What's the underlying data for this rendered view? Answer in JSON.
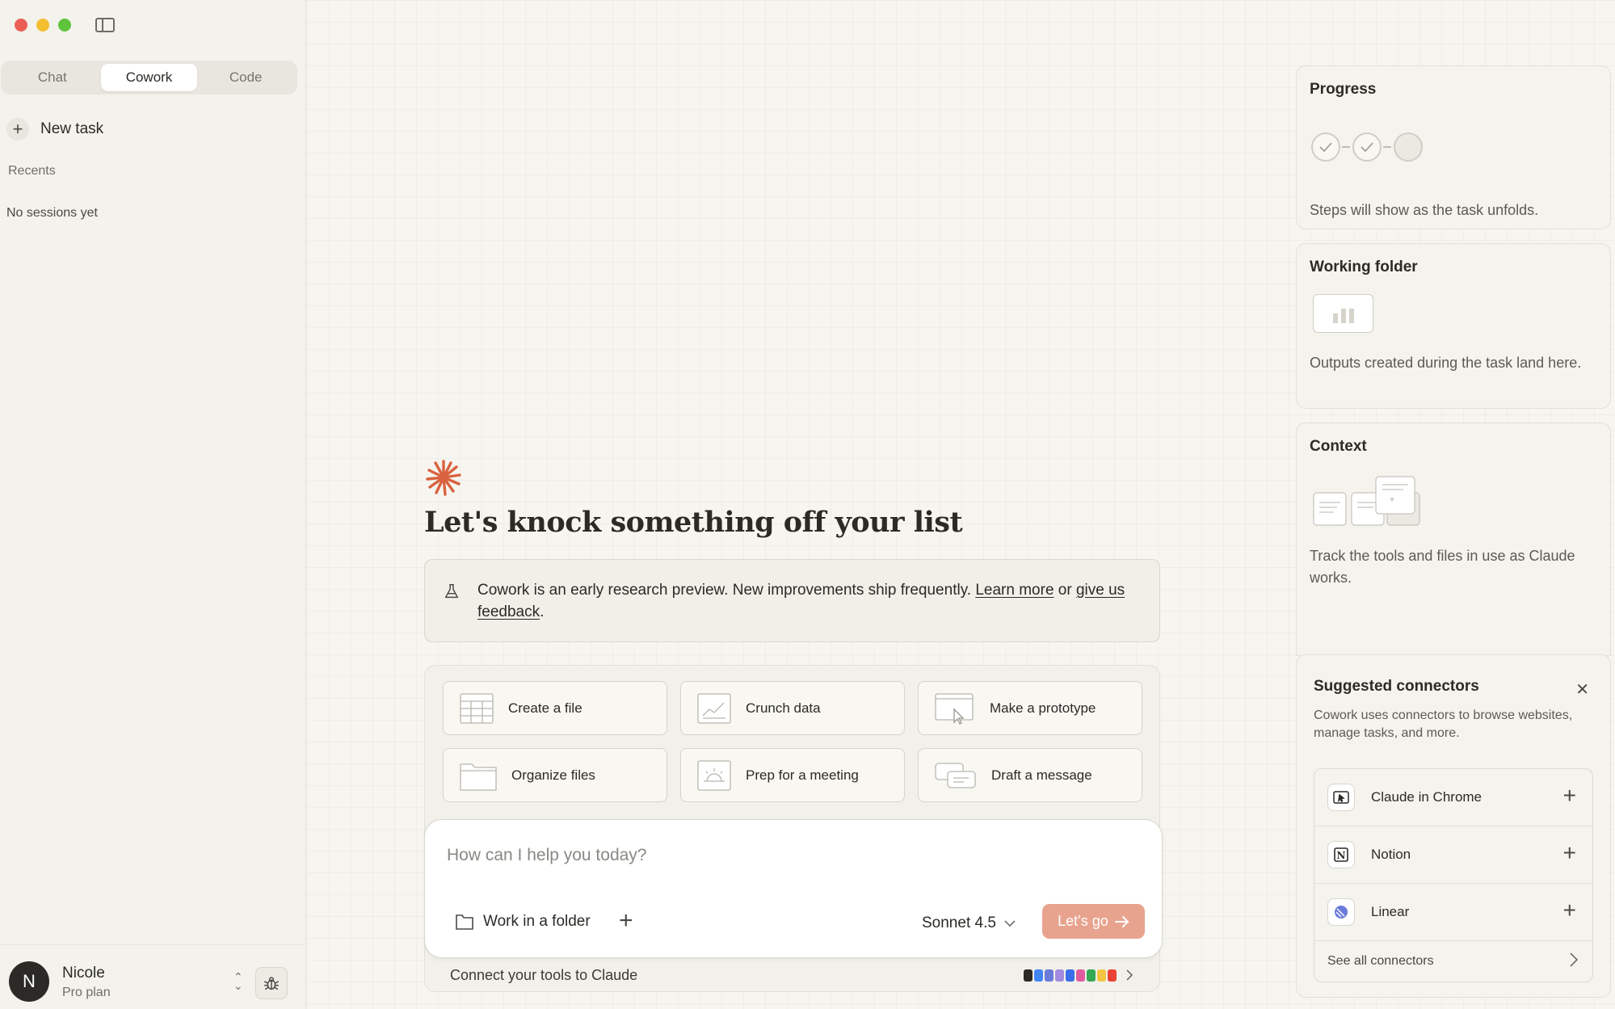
{
  "sidebar": {
    "tabs": [
      {
        "label": "Chat",
        "active": false
      },
      {
        "label": "Cowork",
        "active": true
      },
      {
        "label": "Code",
        "active": false
      }
    ],
    "new_task_label": "New task",
    "recents_label": "Recents",
    "empty_label": "No sessions yet",
    "user": {
      "initial": "N",
      "name": "Nicole",
      "plan": "Pro plan"
    }
  },
  "main": {
    "headline": "Let's knock something off your list",
    "notice": {
      "text_before": "Cowork is an early research preview. New improvements ship frequently. ",
      "learn_more": "Learn more",
      "middle": " or ",
      "feedback": "give us feedback",
      "end": "."
    },
    "actions": [
      {
        "label": "Create a file",
        "icon": "spreadsheet-icon"
      },
      {
        "label": "Crunch data",
        "icon": "chart-icon"
      },
      {
        "label": "Make a prototype",
        "icon": "prototype-icon"
      },
      {
        "label": "Organize files",
        "icon": "folder-icon"
      },
      {
        "label": "Prep for a meeting",
        "icon": "meeting-icon"
      },
      {
        "label": "Draft a message",
        "icon": "message-icon"
      }
    ],
    "composer": {
      "placeholder": "How can I help you today?",
      "folder_label": "Work in a folder",
      "model": "Sonnet 4.5",
      "go_label": "Let’s go"
    },
    "connect_label": "Connect your tools to Claude"
  },
  "right_panel": {
    "progress": {
      "title": "Progress",
      "desc": "Steps will show as the task unfolds."
    },
    "working_folder": {
      "title": "Working folder",
      "desc": "Outputs created during the task land here."
    },
    "context": {
      "title": "Context",
      "desc": "Track the tools and files in use as Claude works."
    },
    "connectors": {
      "title": "Suggested connectors",
      "desc": "Cowork uses connectors to browse websites, manage tasks, and more.",
      "items": [
        {
          "name": "Claude in Chrome",
          "icon": "chrome-extension-icon"
        },
        {
          "name": "Notion",
          "icon": "notion-icon"
        },
        {
          "name": "Linear",
          "icon": "linear-icon"
        }
      ],
      "see_all": "See all connectors"
    }
  },
  "colors": {
    "accent": "#d9623f",
    "go_button": "#e8a38f",
    "background": "#f5f4ee"
  }
}
